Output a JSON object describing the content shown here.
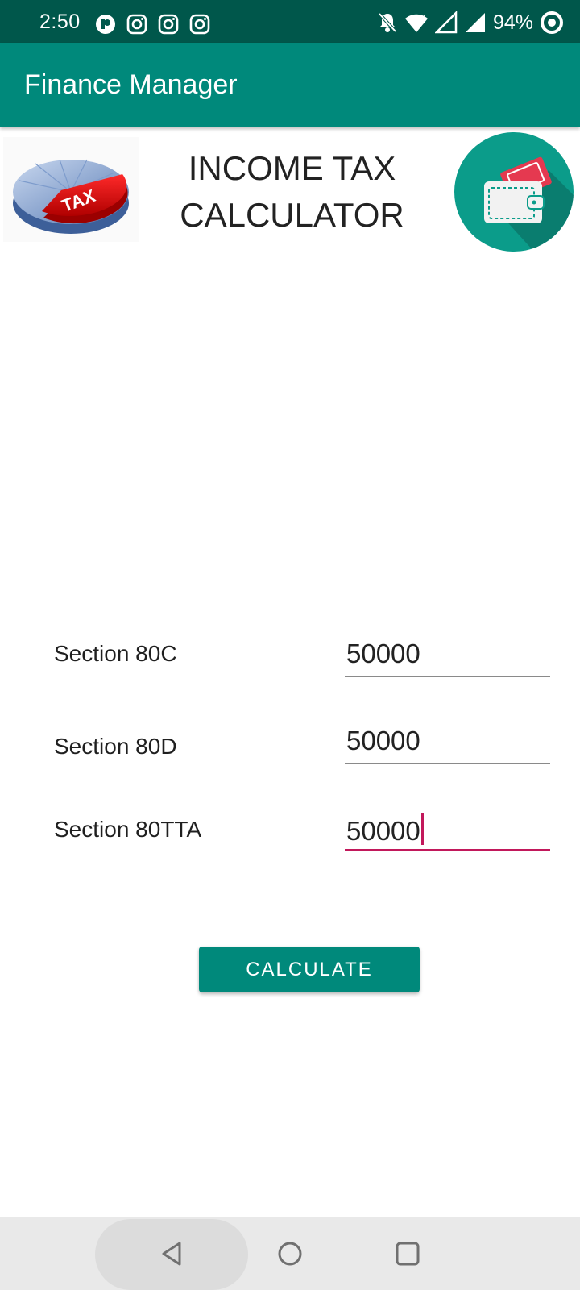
{
  "status_bar": {
    "time": "2:50",
    "battery": "94%",
    "left_icons": [
      "app-notification-icon",
      "instagram-icon",
      "instagram-icon",
      "instagram-icon"
    ],
    "right_icons": [
      "notifications-off-icon",
      "wifi-icon",
      "signal-icon",
      "signal-icon",
      "battery-icon"
    ]
  },
  "app_bar": {
    "title": "Finance Manager",
    "color": "#00897b"
  },
  "header": {
    "title": "INCOME TAX\nCALCULATOR",
    "tax_logo_text": "TAX"
  },
  "form": {
    "rows": [
      {
        "label": "Section 80C",
        "value": "50000"
      },
      {
        "label": "Section 80D",
        "value": "50000"
      },
      {
        "label": "Section 80TTA",
        "value": "50000"
      }
    ],
    "focus_color": "#c2185b"
  },
  "button": {
    "label": "CALCULATE"
  },
  "nav_bar": {
    "items": [
      "back-icon",
      "home-icon",
      "recents-icon"
    ]
  }
}
